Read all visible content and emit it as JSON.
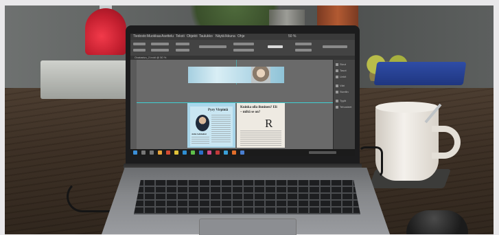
{
  "scene": {
    "description_tags": [
      "laptop",
      "coffee-cup",
      "desk",
      "mouse"
    ]
  },
  "indesign": {
    "menu": [
      "Tiedosto",
      "Muokkaa",
      "Asettelu",
      "Teksti",
      "Objekti",
      "Taulukko",
      "Näytä",
      "Ikkuna",
      "Ohje"
    ],
    "zoom": "50 %",
    "doc_tab": "Ovatasivu_2.indd @ 50 %",
    "panel_items": [
      "Sivut",
      "Tasot",
      "Linkit",
      "Väri",
      "Sivellin",
      "Tyylit",
      "Tehosteet"
    ]
  },
  "article": {
    "left_title": "Pyry Virpiniä",
    "left_subtitle": "Anita Lehtisalmi",
    "right_title": "Kuinka olla ihminen? Eli",
    "right_subtitle": "– miltä se on?",
    "logo_letter": "R"
  },
  "brand_colors": {
    "accent_red": "#d32f2f",
    "guide_cyan": "#3fd1d4",
    "page_blue": "#a9d6ea"
  }
}
